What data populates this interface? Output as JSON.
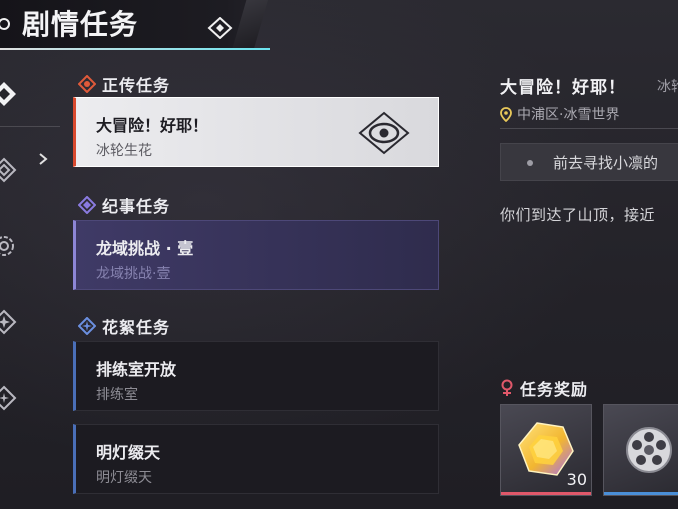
{
  "header": {
    "title": "剧情任务"
  },
  "sections": [
    {
      "name": "正传任务",
      "color": "#e05a3a"
    },
    {
      "name": "纪事任务",
      "color": "#8a7be0"
    },
    {
      "name": "花絮任务",
      "color": "#6b8fe0"
    }
  ],
  "quests": [
    {
      "title": "大冒险！好耶！",
      "subtitle": "冰轮生花"
    },
    {
      "title": "龙域挑战 · 壹",
      "subtitle": "龙域挑战·壹"
    },
    {
      "title": "排练室开放",
      "subtitle": "排练室"
    },
    {
      "title": "明灯缀天",
      "subtitle": "明灯缀天"
    }
  ],
  "detail": {
    "title": "大冒险！好耶！",
    "subtitle": "冰轮",
    "location": "中浦区·冰雪世界",
    "objective": "前去寻找小凛的",
    "description": "你们到达了山顶，接近"
  },
  "rewards": {
    "heading": "任务奖励",
    "items": [
      {
        "icon": "gold-crystal-icon",
        "quantity": "30",
        "rarity_color": "#e0586a"
      },
      {
        "icon": "film-reel-icon",
        "quantity": "",
        "rarity_color": "#4a8fd8"
      }
    ]
  }
}
